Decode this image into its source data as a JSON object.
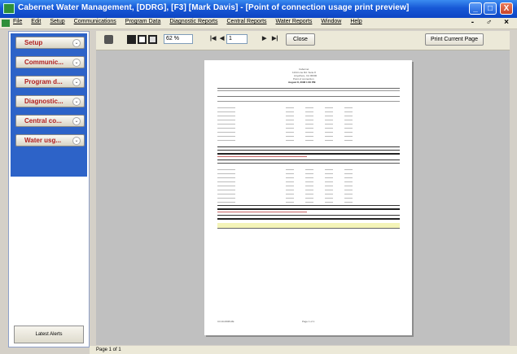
{
  "window": {
    "title": "Cabernet Water Management, [DDRG], [F3]  [Mark Davis] - [Point of connection usage print preview]",
    "minimize": "_",
    "maximize": "□",
    "close": "X"
  },
  "menu": {
    "items": [
      "File",
      "Edit",
      "Setup",
      "Communications",
      "Program Data",
      "Diagnostic Reports",
      "Central Reports",
      "Water Reports",
      "Window",
      "Help"
    ],
    "mdi_controls": "- ♂ ×"
  },
  "sidebar": {
    "items": [
      {
        "label": "Setup"
      },
      {
        "label": "Communic..."
      },
      {
        "label": "Program d..."
      },
      {
        "label": "Diagnostic..."
      },
      {
        "label": "Central co..."
      },
      {
        "label": "Water usg..."
      }
    ],
    "latest_alerts": "Latest Alerts"
  },
  "toolbar": {
    "zoom": "62 %",
    "page_input": "1",
    "close_label": "Close",
    "print_label": "Print Current Page",
    "first_glyph": "|◀",
    "prev_glyph": "◀",
    "next_glyph": "▶",
    "last_glyph": "▶|"
  },
  "report": {
    "header_lines": [
      "Cabernet",
      "1234 Line Rd. Suite 8",
      "Anywhere, CA 00000",
      "Point of connection",
      "August 8, 2008  1:00 PM"
    ],
    "footer_left": "CC10-0608-RE",
    "footer_right": "Page 1 of 1"
  },
  "status": {
    "text": "Page 1 of 1"
  },
  "colors": {
    "title_bar": "#1758d6",
    "sidebar_panel": "#2d63c8",
    "nav_label": "#b02020",
    "preview_bg": "#c0c0c0",
    "highlight_row": "#f4f4b8"
  }
}
